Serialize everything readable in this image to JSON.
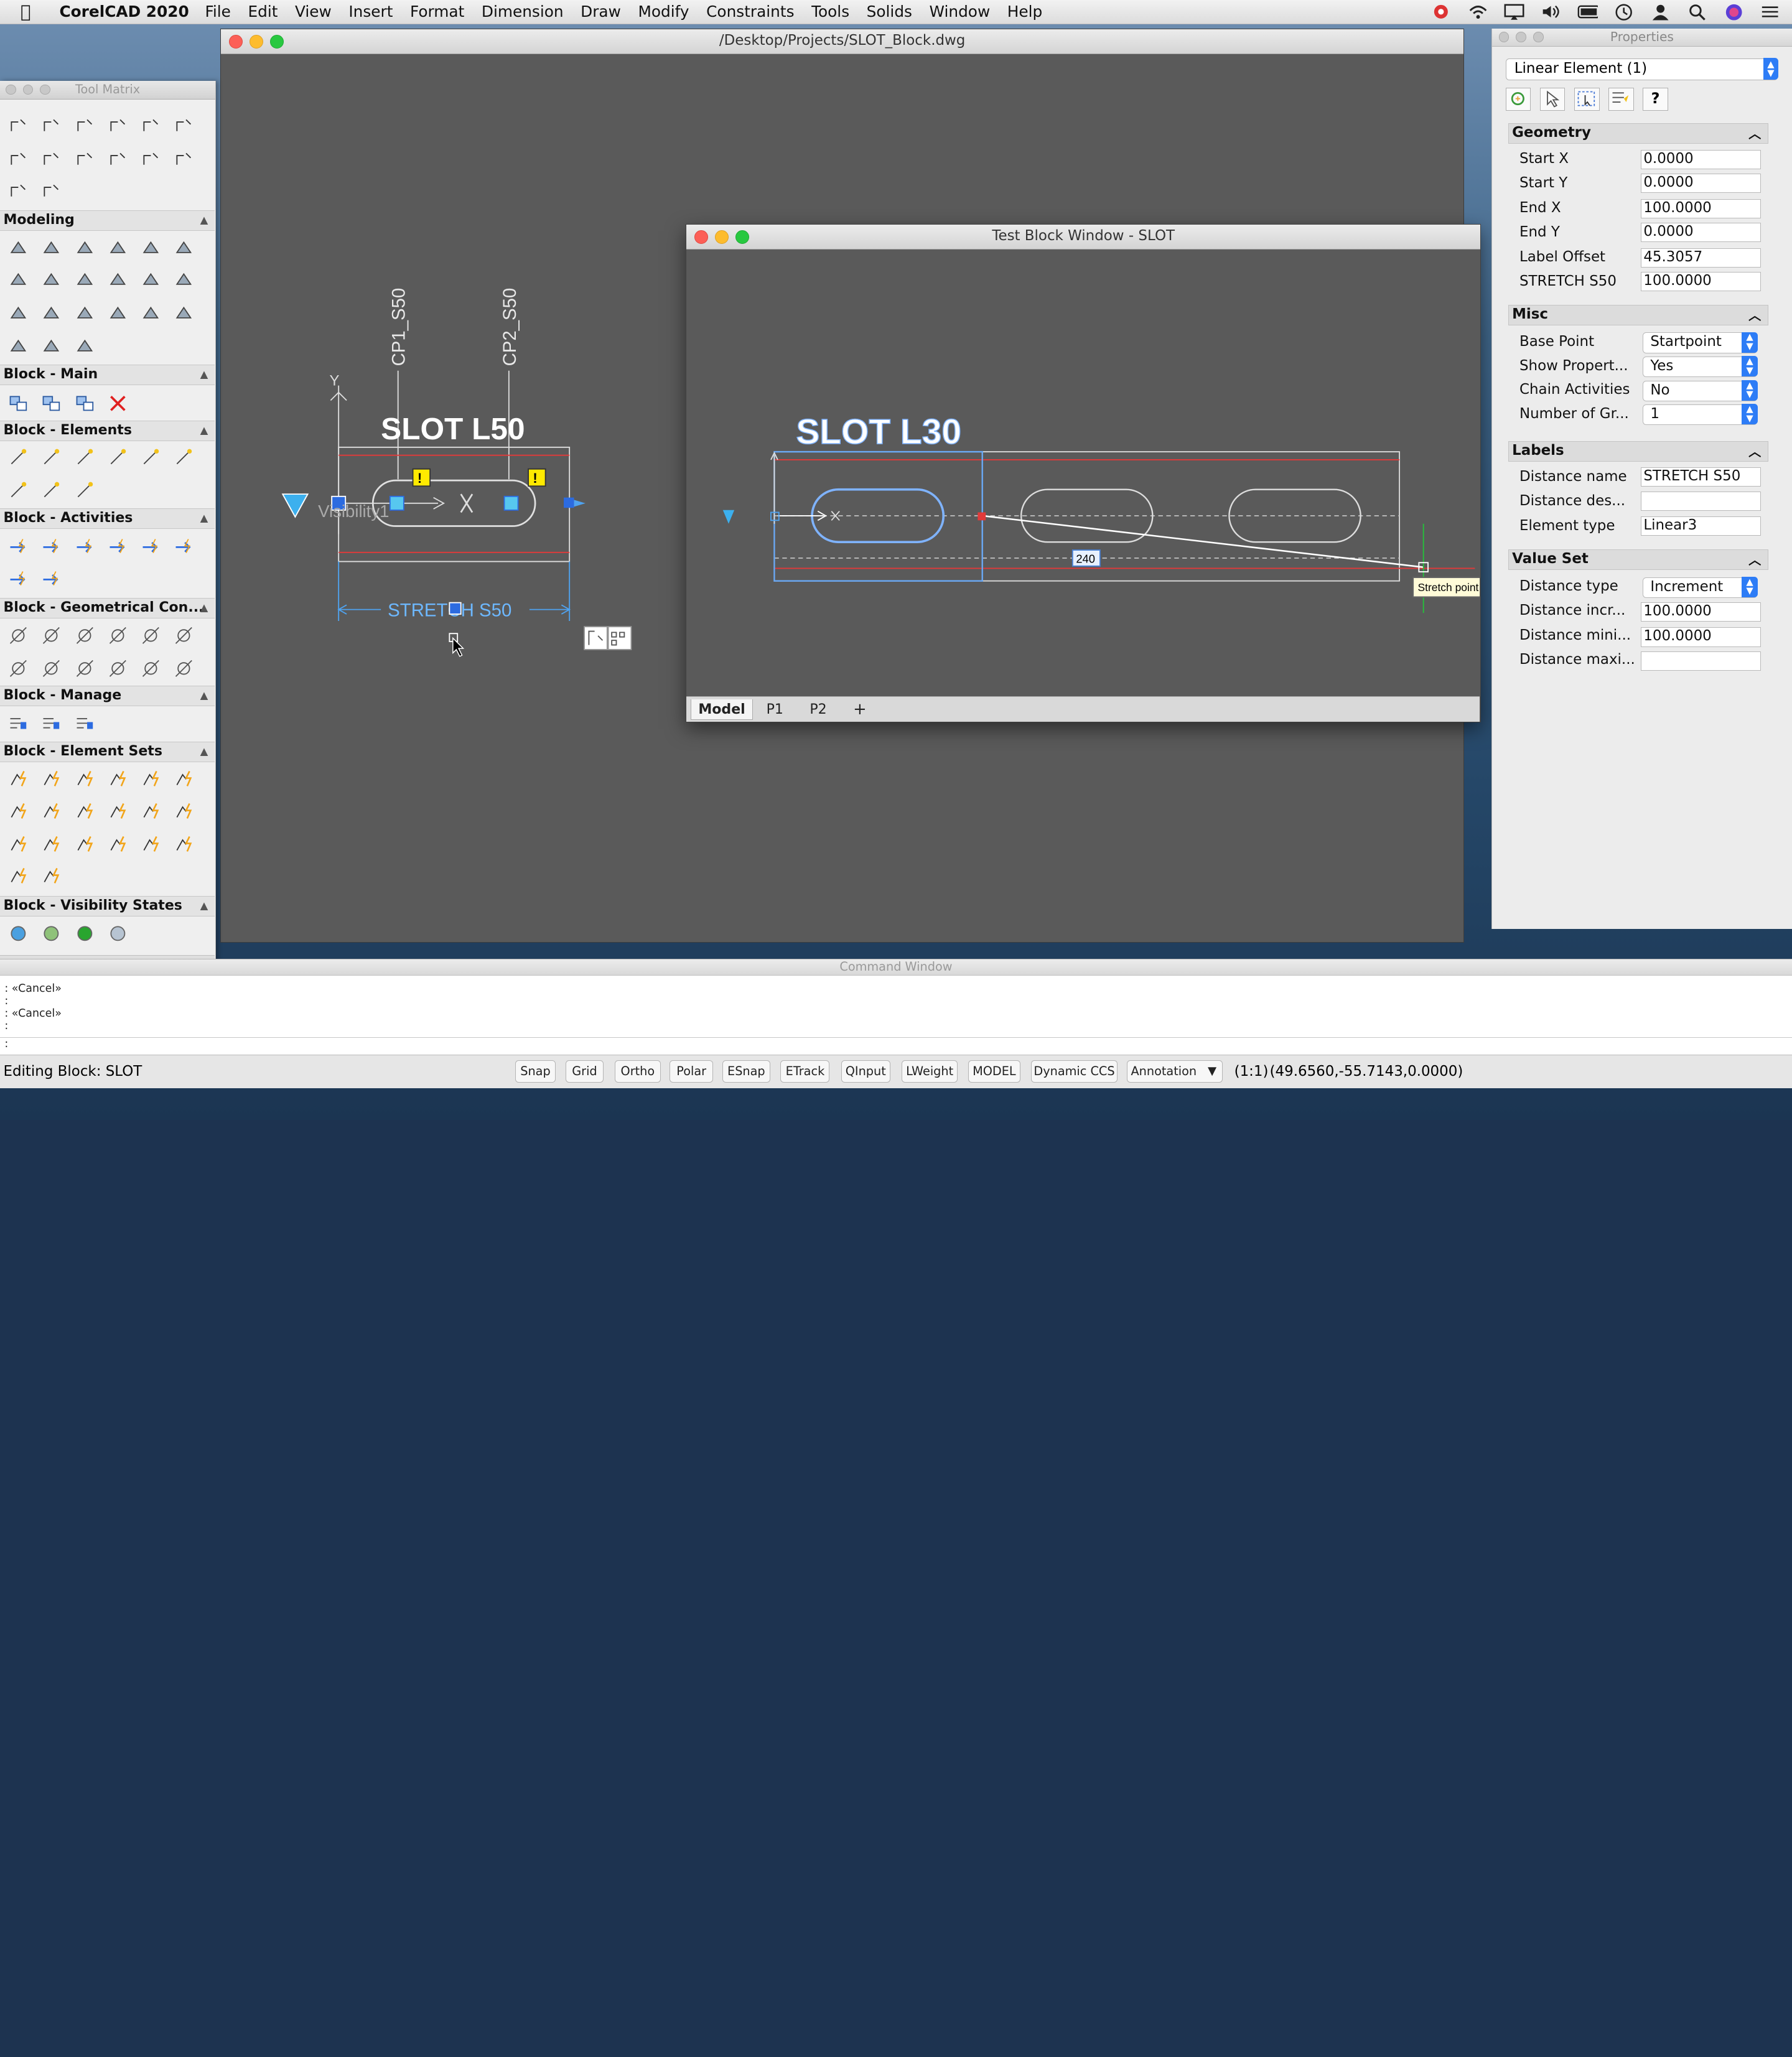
{
  "menubar": {
    "app": "CorelCAD 2020",
    "items": [
      "File",
      "Edit",
      "View",
      "Insert",
      "Format",
      "Dimension",
      "Draw",
      "Modify",
      "Constraints",
      "Tools",
      "Solids",
      "Window",
      "Help"
    ]
  },
  "main_window": {
    "title": "/Desktop/Projects/SLOT_Block.dwg",
    "drawing": {
      "label_cp1": "CP1_S50",
      "label_cp2": "CP2_S50",
      "slot_title": "SLOT L50",
      "visibility_label": "Visibility1",
      "stretch_dim": "STRETCH  S50"
    }
  },
  "tool_matrix": {
    "title": "Tool Matrix",
    "sections": [
      "Modeling",
      "Block - Main",
      "Block - Elements",
      "Block - Activities",
      "Block - Geometrical Con...",
      "Block - Manage",
      "Block - Element Sets",
      "Block - Visibility States"
    ],
    "footer": "◀◀◀◀◀"
  },
  "test_window": {
    "title": "Test Block Window - SLOT",
    "slot_title": "SLOT L30",
    "dim_value": "240",
    "tooltip": "Stretch point",
    "tabs": [
      "Model",
      "P1",
      "P2",
      "+"
    ]
  },
  "properties": {
    "title": "Properties",
    "selector": "Linear Element (1)",
    "help": "?",
    "geometry": {
      "title": "Geometry",
      "rows": [
        {
          "label": "Start X",
          "value": "0.0000"
        },
        {
          "label": "Start Y",
          "value": "0.0000"
        },
        {
          "label": "End X",
          "value": "100.0000"
        },
        {
          "label": "End Y",
          "value": "0.0000"
        },
        {
          "label": "Label Offset",
          "value": "45.3057"
        },
        {
          "label": "STRETCH S50",
          "value": "100.0000"
        }
      ]
    },
    "misc": {
      "title": "Misc",
      "rows": [
        {
          "label": "Base Point",
          "value": "Startpoint"
        },
        {
          "label": "Show Propert...",
          "value": "Yes"
        },
        {
          "label": "Chain Activities",
          "value": "No"
        },
        {
          "label": "Number of Gr...",
          "value": "1"
        }
      ]
    },
    "labels": {
      "title": "Labels",
      "rows": [
        {
          "label": "Distance name",
          "value": "STRETCH S50"
        },
        {
          "label": "Distance des...",
          "value": ""
        },
        {
          "label": "Element type",
          "value": "Linear3"
        }
      ]
    },
    "value_set": {
      "title": "Value Set",
      "rows": [
        {
          "label": "Distance type",
          "value": "Increment"
        },
        {
          "label": "Distance incr...",
          "value": "100.0000"
        },
        {
          "label": "Distance mini...",
          "value": "100.0000"
        },
        {
          "label": "Distance maxi...",
          "value": ""
        }
      ]
    }
  },
  "command_window": {
    "title": "Command Window",
    "lines": [
      ": «Cancel»",
      ":",
      ": «Cancel»",
      ":",
      ":"
    ]
  },
  "statusbar": {
    "left": "Editing Block: SLOT",
    "buttons": [
      "Snap",
      "Grid",
      "Ortho",
      "Polar",
      "ESnap",
      "ETrack",
      "QInput",
      "LWeight",
      "MODEL",
      "Dynamic CCS"
    ],
    "annotation": "Annotation",
    "scale": "(1:1)",
    "coords": "(49.6560,-55.7143,0.0000)"
  }
}
